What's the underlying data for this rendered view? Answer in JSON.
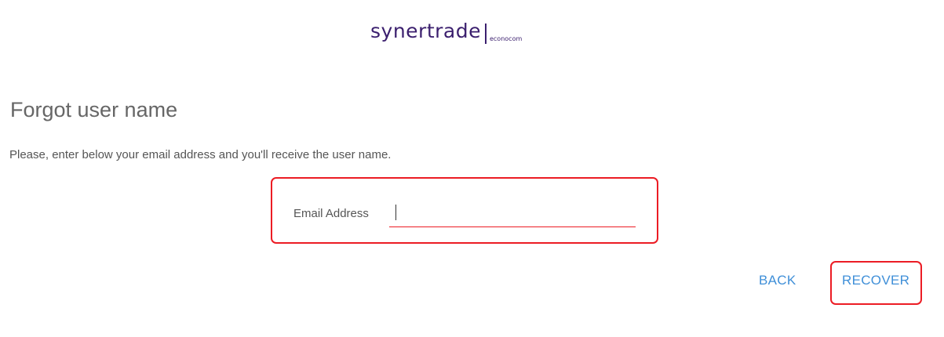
{
  "logo": {
    "main": "synertrade",
    "sub": "econocom"
  },
  "page": {
    "title": "Forgot user name",
    "instructions": "Please, enter below your email address and you'll receive the user name."
  },
  "form": {
    "email_label": "Email Address",
    "email_value": ""
  },
  "actions": {
    "back_label": "BACK",
    "recover_label": "RECOVER"
  },
  "colors": {
    "accent": "#3f8fd8",
    "highlight": "#ec1c24",
    "brand": "#3b1f6e"
  }
}
